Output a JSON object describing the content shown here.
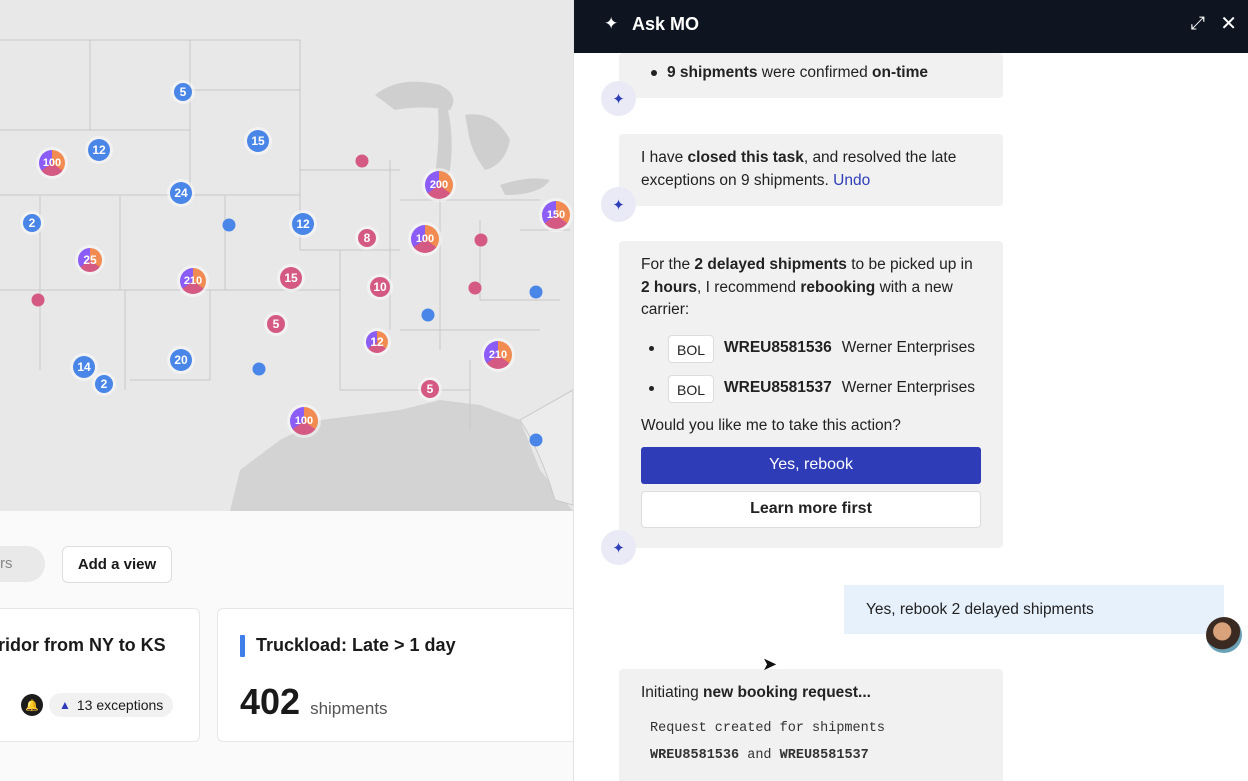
{
  "map": {
    "clusters": [
      {
        "label": "5",
        "kind": "blue"
      },
      {
        "label": "12",
        "kind": "blue"
      },
      {
        "label": "100",
        "kind": "multi"
      },
      {
        "label": "15",
        "kind": "blue"
      },
      {
        "label": "24",
        "kind": "blue"
      },
      {
        "label": "2",
        "kind": "blue"
      },
      {
        "label": "12",
        "kind": "blue"
      },
      {
        "label": "25",
        "kind": "multi"
      },
      {
        "label": "210",
        "kind": "multi"
      },
      {
        "label": "8",
        "kind": "pink"
      },
      {
        "label": "15",
        "kind": "pink"
      },
      {
        "label": "10",
        "kind": "pink"
      },
      {
        "label": "5",
        "kind": "pink"
      },
      {
        "label": "100",
        "kind": "multi"
      },
      {
        "label": "200",
        "kind": "multi"
      },
      {
        "label": "150",
        "kind": "multi"
      },
      {
        "label": "12",
        "kind": "multi"
      },
      {
        "label": "210",
        "kind": "multi"
      },
      {
        "label": "14",
        "kind": "blue"
      },
      {
        "label": "2",
        "kind": "blue"
      },
      {
        "label": "20",
        "kind": "blue"
      },
      {
        "label": "5",
        "kind": "pink"
      },
      {
        "label": "100",
        "kind": "multi"
      }
    ],
    "colors": {
      "blue": "#4a86e8",
      "pink": "#d45a84",
      "multi_a": "#f28b52",
      "multi_b": "#8b5cf6"
    }
  },
  "toolbar": {
    "filter_partial": "rs",
    "add_view": "Add a view"
  },
  "cards": [
    {
      "title": "rridor from NY to KS",
      "exceptions": "13 exceptions"
    },
    {
      "title": "Truckload: Late > 1 day",
      "count": "402",
      "unit": "shipments"
    }
  ],
  "panel": {
    "title": "Ask MO",
    "msg1": {
      "count": "9 shipments",
      "middle": " were confirmed ",
      "status": "on-time"
    },
    "msg2": {
      "pre": "I have ",
      "bold": "closed this task",
      "post": ", and resolved the late exceptions on 9 shipments. ",
      "undo": "Undo"
    },
    "msg3": {
      "p1": "For the ",
      "b1": "2 delayed shipments",
      "p2": " to be picked up in ",
      "b2": "2 hours",
      "p3": ", I recommend ",
      "b3": "rebooking",
      "p4": " with a new carrier:",
      "bols": [
        {
          "tag": "BOL",
          "id": "WREU8581536",
          "carrier": "Werner Enterprises"
        },
        {
          "tag": "BOL",
          "id": "WREU8581537",
          "carrier": "Werner Enterprises"
        }
      ],
      "question": "Would you like me to take this action?",
      "primary": "Yes, rebook",
      "secondary": "Learn more first"
    },
    "user_msg": "Yes, rebook 2 delayed shipments",
    "msg4": {
      "pre": "Initiating ",
      "bold": "new booking request...",
      "line1": "Request created for shipments",
      "id1": "WREU8581536",
      "and": " and ",
      "id2": "WREU8581537"
    }
  }
}
